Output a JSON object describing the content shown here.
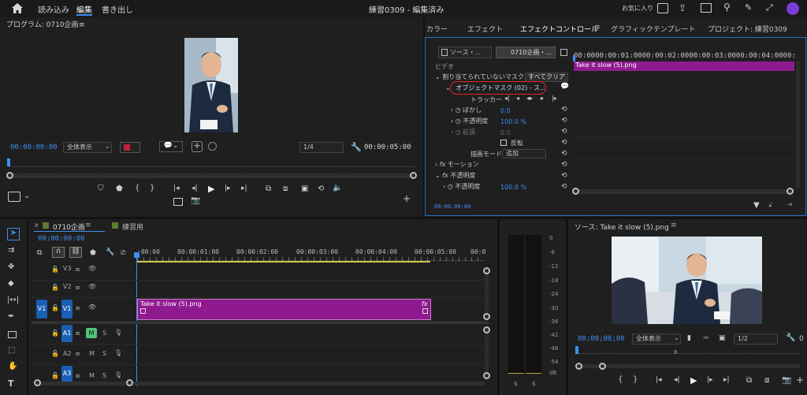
{
  "menubar": {
    "home_icon": "home-icon",
    "items": [
      "読み込み",
      "編集",
      "書き出し"
    ],
    "title": "練習0309 - 編集済み",
    "favorites": "お気に入り"
  },
  "program": {
    "title": "プログラム: 0710企画",
    "menu_glyph": "≡",
    "timecode_in": "00:00:00:00",
    "zoom": "全体表示",
    "resolution": "1/4",
    "timecode_out": "00:00:05:00"
  },
  "effect_panel": {
    "tabs": [
      "カラー",
      "エフェクト",
      "エフェクトコントロール",
      "グラフィックテンプレート",
      "プロジェクト: 練習0309"
    ],
    "tab_menu_glyph": "≡",
    "source_label": "ソース・...",
    "clip_label": "0710企画・...",
    "section_video": "ビデオ",
    "unassigned_mask": "割り当てられていないマスク",
    "clear_all": "すべてクリア",
    "object_mask": "オブジェクトマスク (02) - ス...",
    "tracker": "トラッカー",
    "feather_label": "ぼかし",
    "feather_value": "0.0",
    "opacity_label": "不透明度",
    "opacity_value": "100.0 %",
    "expand_label": "拡張",
    "expand_value": "0.0",
    "invert_label": "反転",
    "blend_mode_label": "描画モード",
    "blend_mode_value": "追加",
    "fx_prefix": "fx",
    "motion_label": "モーション",
    "opacity_section": "不透明度",
    "opacity2_label": "不透明度",
    "opacity2_value": "100.0 %",
    "timecode": "00:00:00:00",
    "mini_ruler": [
      "00:00",
      "00:00:01:00",
      "00:00:02:00",
      "00:00:03:00",
      "00:00:04:00",
      "00:00"
    ],
    "mini_clip": "Take it slow (5).png"
  },
  "timeline": {
    "tab_active": "0710企画",
    "tab_other": "練習用",
    "tab_close": "×",
    "menu_glyph": "≡",
    "timecode": "00:00:00:00",
    "ruler": [
      ":00:00",
      "00:00:01:00",
      "00:00:02:00",
      "00:00:03:00",
      "00:00:04:00",
      "00:00:05:00",
      "00:0"
    ],
    "tracks": [
      {
        "name": "V3"
      },
      {
        "name": "V2"
      },
      {
        "name": "V1",
        "src": "V1"
      },
      {
        "name": "A1",
        "m": "M",
        "s": "S"
      },
      {
        "name": "A2",
        "m": "M",
        "s": "S"
      },
      {
        "name": "A3",
        "m": "M",
        "s": "S"
      }
    ],
    "clip_label": "Take it slow (5).png",
    "clip_fx": "fx",
    "clip_color": "#8f1a8f"
  },
  "vu": {
    "labels": [
      "0",
      "-6",
      "-12",
      "-18",
      "-24",
      "-30",
      "-36",
      "-42",
      "-48",
      "-54",
      "dB"
    ],
    "solo_left": "S",
    "solo_right": "S"
  },
  "source": {
    "title": "ソース: Take it slow (5).png",
    "menu_glyph": "≡",
    "timecode": "00;00;00;00",
    "zoom": "全体表示",
    "resolution": "1/2",
    "playhead_marker": "B"
  },
  "colors": {
    "accent": "#3d8ff3",
    "clip": "#8f1a8f",
    "mask_ring": "#e0261f",
    "selected_track": "#1a5fb4"
  }
}
